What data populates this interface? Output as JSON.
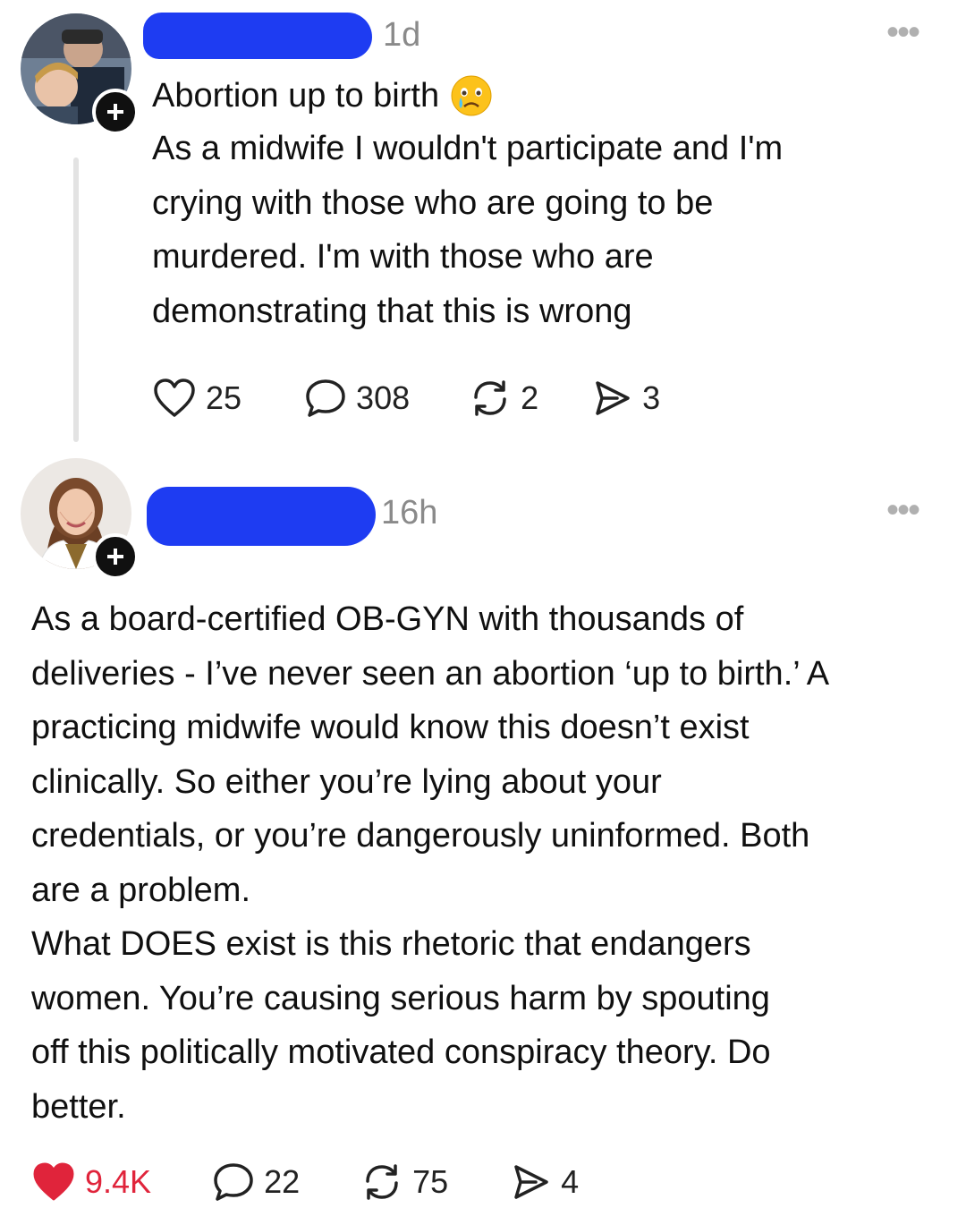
{
  "post": {
    "author_redacted": true,
    "timestamp": "1d",
    "title": "Abortion up to birth",
    "title_emoji": "crying-face",
    "body": "As a midwife I wouldn't participate and I'm\ncrying with those who are going to be\nmurdered. I'm with those who are\ndemonstrating that this is wrong",
    "likes": "25",
    "replies": "308",
    "reposts": "2",
    "shares": "3",
    "liked": false
  },
  "reply": {
    "author_redacted": true,
    "timestamp": "16h",
    "body": "As a board-certified OB-GYN with thousands of\ndeliveries - I’ve never seen an abortion ‘up to birth.’ A\npracticing midwife would know this doesn’t exist\nclinically. So either you’re lying about your\ncredentials, or you’re dangerously uninformed. Both\nare a problem.\nWhat DOES exist is this rhetoric that endangers\nwomen. You’re causing serious harm by spouting\noff this politically motivated conspiracy theory. Do\nbetter.",
    "likes": "9.4K",
    "replies": "22",
    "reposts": "75",
    "shares": "4",
    "liked": true
  },
  "colors": {
    "redaction": "#1e3cf2",
    "like_active": "#e0243b",
    "muted": "#8a8a8a"
  }
}
